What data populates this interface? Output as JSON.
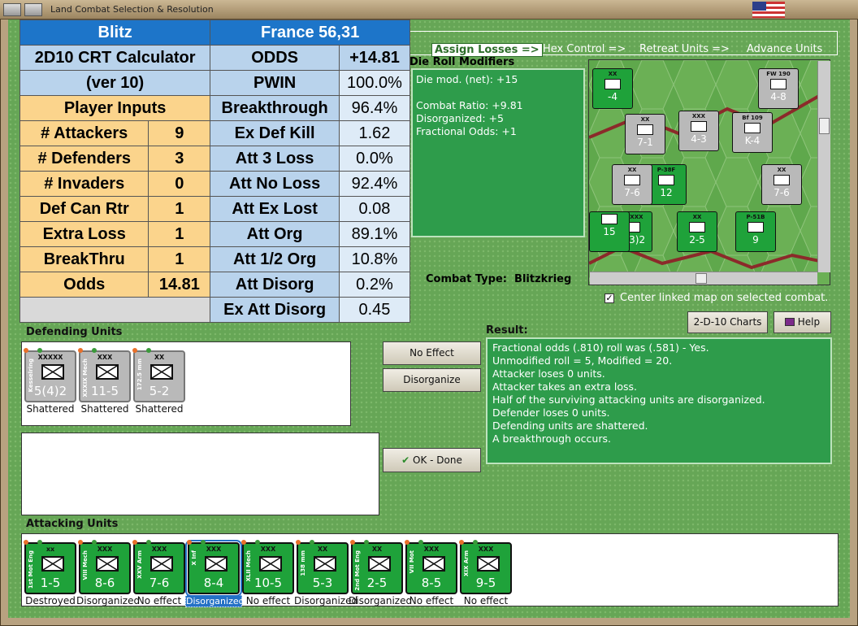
{
  "window": {
    "title": "Land Combat Selection & Resolution"
  },
  "crt": {
    "title": "Blitz",
    "calc": "2D10 CRT Calculator",
    "ver": "(ver 10)",
    "player_inputs": "Player Inputs",
    "inputs": [
      [
        "# Attackers",
        "9"
      ],
      [
        "# Defenders",
        "3"
      ],
      [
        "# Invaders",
        "0"
      ],
      [
        "Def Can Rtr",
        "1"
      ],
      [
        "Extra Loss",
        "1"
      ],
      [
        "BreakThru",
        "1"
      ],
      [
        "Odds",
        "14.81"
      ]
    ],
    "header2": "France 56,31",
    "odds_label": "ODDS",
    "odds_value": "+14.81",
    "results": [
      [
        "PWIN",
        "100.0%"
      ],
      [
        "Breakthrough",
        "96.4%"
      ],
      [
        "Ex Def Kill",
        "1.62"
      ],
      [
        "Att 3 Loss",
        "0.0%"
      ],
      [
        "Att No Loss",
        "92.4%"
      ],
      [
        "Att Ex Lost",
        "0.08"
      ],
      [
        "Att Org",
        "89.1%"
      ],
      [
        "Att 1/2 Org",
        "10.8%"
      ],
      [
        "Att Disorg",
        "0.2%"
      ],
      [
        "Ex Att Disorg",
        "0.45"
      ]
    ]
  },
  "tabs": [
    "Assign Losses =>",
    "Hex Control =>",
    "Retreat Units =>",
    "Advance Units"
  ],
  "die": {
    "title": "Die Roll Modifiers",
    "lines": [
      "Die mod. (net): +15",
      "",
      "Combat Ratio: +9.81",
      "Disorganized: +5",
      "Fractional Odds: +1"
    ]
  },
  "combat_type": {
    "label": "Combat Type:",
    "value": "Blitzkrieg"
  },
  "center_map": {
    "checked": "✓",
    "label": "Center linked map on selected combat."
  },
  "buttons": {
    "charts": "2-D-10 Charts",
    "help": "Help",
    "no_effect": "No Effect",
    "disorganize": "Disorganize",
    "ok": "OK - Done"
  },
  "defending": {
    "title": "Defending Units",
    "units": [
      {
        "size": "XXXXX",
        "vt": "Kesselring",
        "num": "5(4)2",
        "status": "Shattered"
      },
      {
        "size": "XXX",
        "vt": "XXXIX Mech",
        "num": "11-5",
        "status": "Shattered"
      },
      {
        "size": "XX",
        "vt": "172.5 mm",
        "num": "5-2",
        "status": "Shattered"
      }
    ]
  },
  "result": {
    "title": "Result:",
    "lines": [
      "Fractional odds (.810) roll was (.581)  - Yes.",
      "Unmodified roll = 5, Modified = 20.",
      "Attacker loses 0 units.",
      "Attacker takes an extra loss.",
      "Half of the surviving attacking units are disorganized.",
      "Defender loses 0 units.",
      "Defending units are shattered.",
      "A breakthrough occurs."
    ]
  },
  "attacking": {
    "title": "Attacking Units",
    "units": [
      {
        "size": "xx",
        "vt": "1st Mot Eng",
        "num": "1-5",
        "status": "Destroyed"
      },
      {
        "size": "XXX",
        "vt": "VIII Mech",
        "num": "8-6",
        "status": "Disorganized"
      },
      {
        "size": "XXX",
        "vt": "XXV Arm",
        "num": "7-6",
        "status": "No effect"
      },
      {
        "size": "XXX",
        "vt": "X Inf",
        "num": "8-4",
        "status": "Disorganized"
      },
      {
        "size": "XXX",
        "vt": "XLII Mech",
        "num": "10-5",
        "status": "No effect"
      },
      {
        "size": "XX",
        "vt": "138 mm",
        "num": "5-3",
        "status": "Disorganized"
      },
      {
        "size": "XX",
        "vt": "2nd Mot Eng",
        "num": "2-5",
        "status": "Disorganized"
      },
      {
        "size": "XXX",
        "vt": "VII Mot",
        "num": "8-5",
        "status": "No effect"
      },
      {
        "size": "XXX",
        "vt": "XIX Arm",
        "num": "9-5",
        "status": "No effect"
      }
    ]
  },
  "map_counters": [
    {
      "size": "XX",
      "num": "-4"
    },
    {
      "size": "FW 190",
      "num": "4-8"
    },
    {
      "size": "XX",
      "num": "7-1"
    },
    {
      "size": "XXX",
      "num": "4-3"
    },
    {
      "size": "Bf 109",
      "num": "K-4"
    },
    {
      "size": "P-38F",
      "num": "12"
    },
    {
      "size": "XX",
      "num": "7-6"
    },
    {
      "size": "XX",
      "num": "7-6"
    },
    {
      "size": "XXXXX",
      "num": "5(3)2"
    },
    {
      "size": "XX",
      "num": "2-5"
    },
    {
      "size": "P-51B",
      "num": "9"
    },
    {
      "size": "",
      "num": "15"
    }
  ]
}
